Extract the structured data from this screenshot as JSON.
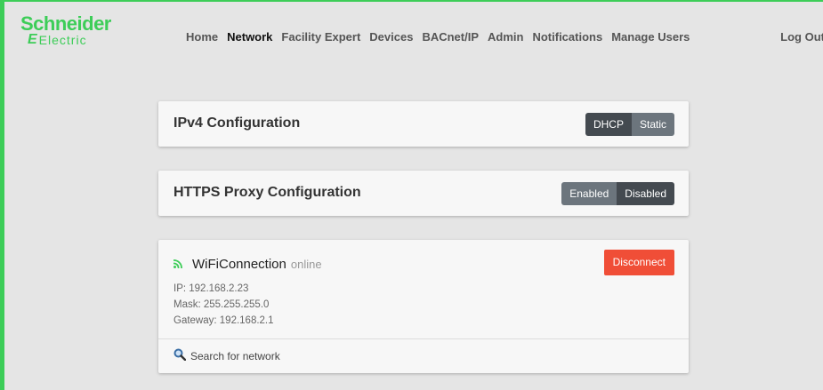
{
  "brand": {
    "line1": "Schneider",
    "line2": "Electric",
    "mark": "E"
  },
  "nav": {
    "items": [
      {
        "label": "Home"
      },
      {
        "label": "Network"
      },
      {
        "label": "Facility Expert"
      },
      {
        "label": "Devices"
      },
      {
        "label": "BACnet/IP"
      },
      {
        "label": "Admin"
      },
      {
        "label": "Notifications"
      },
      {
        "label": "Manage Users"
      }
    ],
    "active": "Network",
    "logout": "Log Out"
  },
  "ipv4": {
    "title": "IPv4 Configuration",
    "options": [
      "DHCP",
      "Static"
    ],
    "selected": "DHCP"
  },
  "proxy": {
    "title": "HTTPS Proxy Configuration",
    "options": [
      "Enabled",
      "Disabled"
    ],
    "selected": "Disabled"
  },
  "wifi": {
    "icon": "wifi-signal-icon",
    "name": "WiFiConnection",
    "status": "online",
    "ip": "IP: 192.168.2.23",
    "mask": "Mask: 255.255.255.0",
    "gateway": "Gateway: 192.168.2.1",
    "disconnect_label": "Disconnect",
    "search_label": "Search for network"
  },
  "colors": {
    "brand_green": "#3dcd58",
    "danger": "#f04e37",
    "toggle_on": "#444a50",
    "toggle_off": "#6c757d"
  }
}
